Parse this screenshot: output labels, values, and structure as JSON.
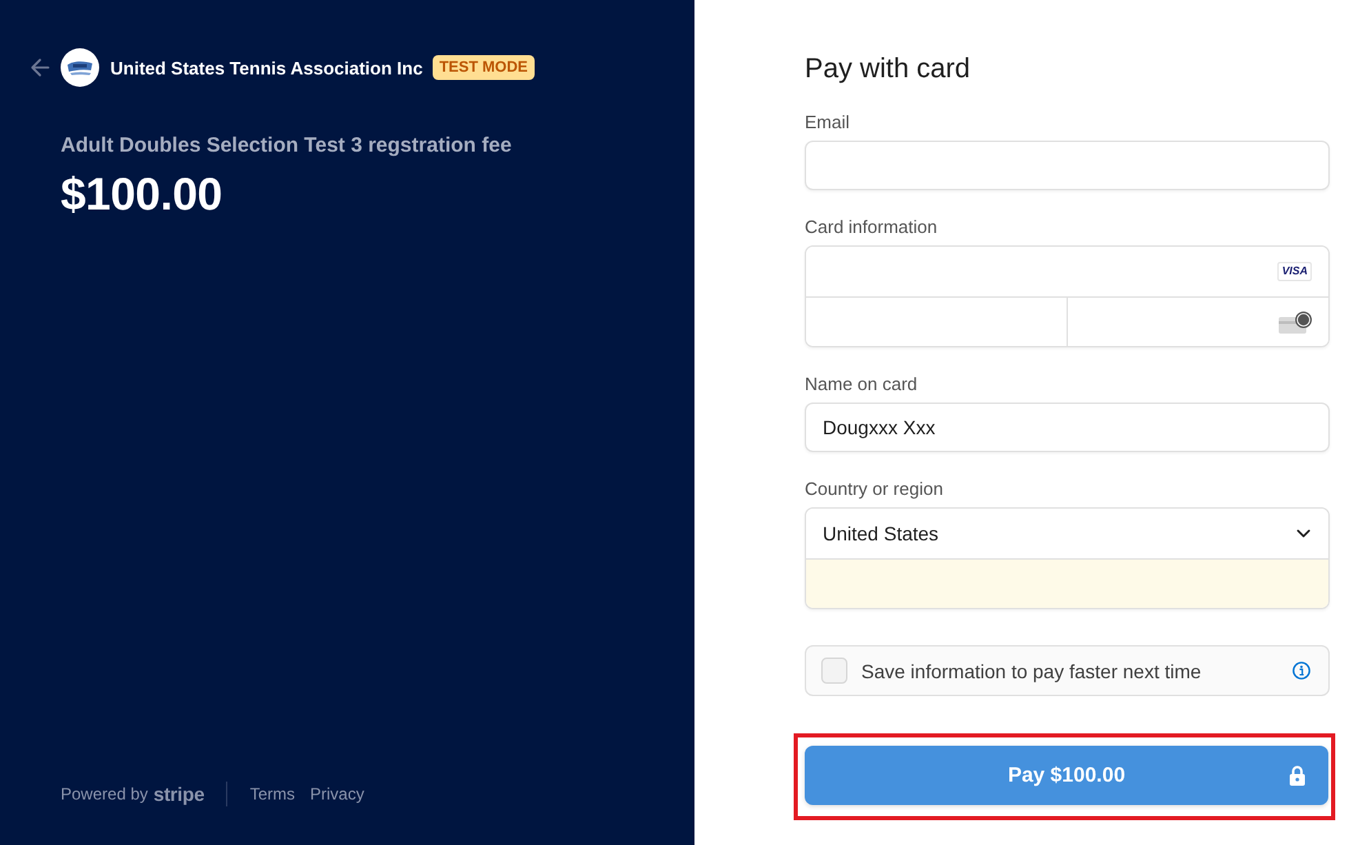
{
  "merchant": {
    "name": "United States Tennis Association Inc",
    "badge": "TEST MODE"
  },
  "product": {
    "title": "Adult Doubles Selection Test 3 regstration fee",
    "price": "$100.00"
  },
  "footer": {
    "powered_by": "Powered by",
    "brand": "stripe",
    "links": [
      "Terms",
      "Privacy"
    ]
  },
  "form": {
    "title": "Pay with card",
    "fields": [
      {
        "kind": "text",
        "label": "Email"
      },
      {
        "kind": "card",
        "label": "Card information",
        "card_brand": "VISA"
      },
      {
        "kind": "text",
        "label": "Name on card",
        "value": "Dougxxx Xxx"
      },
      {
        "kind": "address",
        "label": "Country or region",
        "value": "United States",
        "autofilled": true
      }
    ],
    "save_option": {
      "label": "Save information to pay faster next time",
      "checked": false
    },
    "pay_button": {
      "label": "Pay $100.00",
      "highlighted": true
    }
  }
}
